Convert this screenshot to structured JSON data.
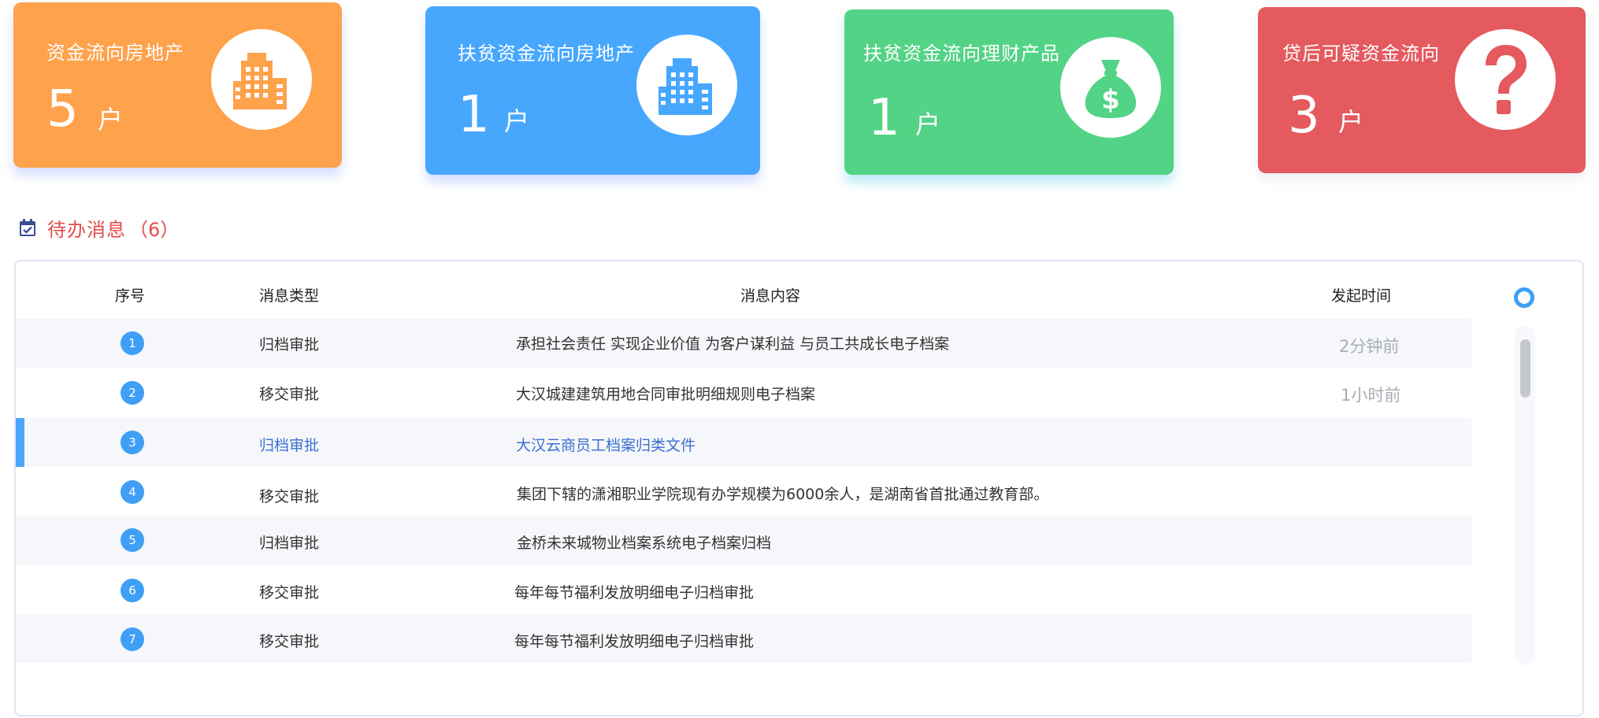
{
  "stats": [
    {
      "title": "资金流向房地产",
      "value": "5",
      "unit": "户",
      "icon": "building-icon",
      "color": "#ffa24c"
    },
    {
      "title": "扶贫资金流向房地产",
      "value": "1",
      "unit": "户",
      "icon": "building-icon",
      "color": "#47a7fd"
    },
    {
      "title": "扶贫资金流向理财产品",
      "value": "1",
      "unit": "户",
      "icon": "money-bag-icon",
      "color": "#53d385"
    },
    {
      "title": "贷后可疑资金流向",
      "value": "3",
      "unit": "户",
      "icon": "question-icon",
      "color": "#e45a5f"
    }
  ],
  "todo": {
    "title": "待办消息",
    "count": "（6）",
    "icon": "calendar-icon"
  },
  "table": {
    "headers": {
      "no": "序号",
      "type": "消息类型",
      "content": "消息内容",
      "time": "发起时间"
    },
    "rows": [
      {
        "no": "1",
        "type": "归档审批",
        "content": "承担社会责任 实现企业价值 为客户谋利益 与员工共成长电子档案",
        "time": "2分钟前"
      },
      {
        "no": "2",
        "type": "移交审批",
        "content": "大汉城建建筑用地合同审批明细规则电子档案",
        "time": "1小时前"
      },
      {
        "no": "3",
        "type": "归档审批",
        "content": "大汉云商员工档案归类文件",
        "time": ""
      },
      {
        "no": "4",
        "type": "移交审批",
        "content": "集团下辖的潇湘职业学院现有办学规模为6000余人，是湖南省首批通过教育部。",
        "time": ""
      },
      {
        "no": "5",
        "type": "归档审批",
        "content": "金桥未来城物业档案系统电子档案归档",
        "time": ""
      },
      {
        "no": "6",
        "type": "移交审批",
        "content": "每年每节福利发放明细电子归档审批",
        "time": ""
      },
      {
        "no": "7",
        "type": "移交审批",
        "content": "每年每节福利发放明细电子归档审批",
        "time": ""
      }
    ]
  },
  "colors": {
    "accent": "#3f9ff5",
    "title_red": "#e44b4b",
    "selected_text": "#3a6fd1"
  }
}
